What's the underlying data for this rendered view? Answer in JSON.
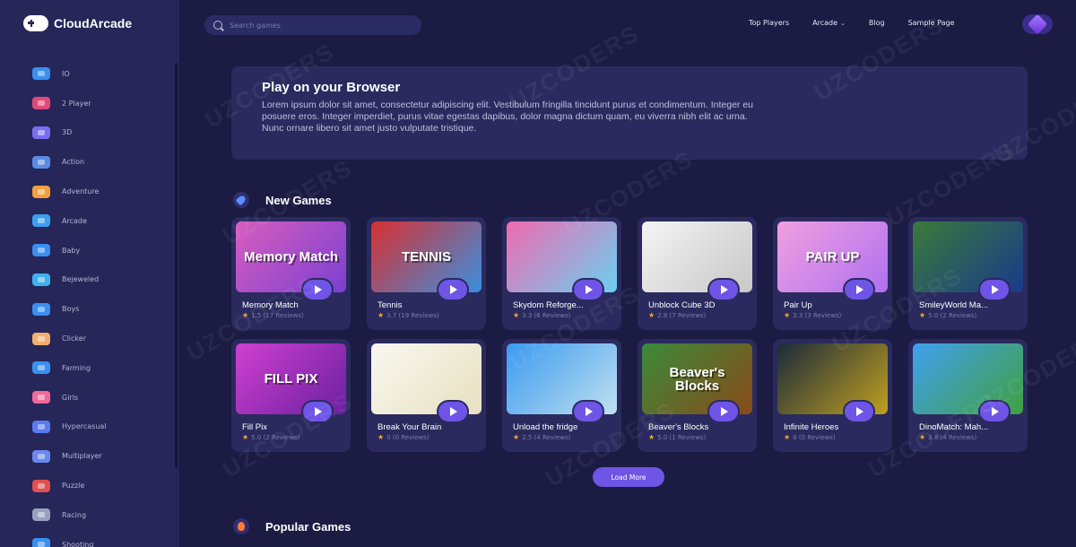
{
  "brand": {
    "name": "CloudArcade",
    "logo_icon": "gamepad-icon"
  },
  "search": {
    "placeholder": "Search games"
  },
  "nav": {
    "items": [
      {
        "label": "Top Players"
      },
      {
        "label": "Arcade",
        "has_dropdown": true,
        "chevron": "⌄"
      },
      {
        "label": "Blog"
      },
      {
        "label": "Sample Page"
      }
    ]
  },
  "sidebar": {
    "categories": [
      {
        "label": "IO",
        "icon": "gamepad-icon",
        "color": "#3a8ff0"
      },
      {
        "label": "2 Player",
        "icon": "two-player-icon",
        "color": "#e04a7a"
      },
      {
        "label": "3D",
        "icon": "cube-icon",
        "color": "#7a6cf0"
      },
      {
        "label": "Action",
        "icon": "swords-icon",
        "color": "#5a8be0"
      },
      {
        "label": "Adventure",
        "icon": "map-icon",
        "color": "#f0a040"
      },
      {
        "label": "Arcade",
        "icon": "arcade-icon",
        "color": "#3a9ff0"
      },
      {
        "label": "Baby",
        "icon": "gamepad-icon",
        "color": "#3a8ff0"
      },
      {
        "label": "Bejeweled",
        "icon": "diamond-icon",
        "color": "#40b0f0"
      },
      {
        "label": "Boys",
        "icon": "gamepad-icon",
        "color": "#3a8ff0"
      },
      {
        "label": "Clicker",
        "icon": "hand-pointer-icon",
        "color": "#f0b070"
      },
      {
        "label": "Farming",
        "icon": "gamepad-icon",
        "color": "#3a8ff0"
      },
      {
        "label": "Girls",
        "icon": "face-icon",
        "color": "#f06a9a"
      },
      {
        "label": "Hypercasual",
        "icon": "runner-icon",
        "color": "#5a7af0"
      },
      {
        "label": "Multiplayer",
        "icon": "players-icon",
        "color": "#6a8af0"
      },
      {
        "label": "Puzzle",
        "icon": "puzzle-icon",
        "color": "#e05050"
      },
      {
        "label": "Racing",
        "icon": "flag-icon",
        "color": "#9aa0c0"
      },
      {
        "label": "Shooting",
        "icon": "gamepad-icon",
        "color": "#3a8ff0"
      }
    ]
  },
  "hero": {
    "title": "Play on your Browser",
    "text": "Lorem ipsum dolor sit amet, consectetur adipiscing elit. Vestibulum fringilla tincidunt purus et condimentum. Integer eu posuere eros. Integer imperdiet, purus vitae egestas dapibus, dolor magna dictum quam, eu viverra nibh elit ac urna. Nunc ornare libero sit amet justo vulputate tristique."
  },
  "sections": {
    "new_games": {
      "title": "New Games",
      "icon": "rocket-icon"
    },
    "popular_games": {
      "title": "Popular Games",
      "icon": "fire-icon"
    }
  },
  "games": [
    {
      "title": "Memory Match",
      "rating": "1.5 (17 Reviews)",
      "thumb_text": "Memory Match",
      "colors": [
        "#d85ec0",
        "#7a3fd0"
      ]
    },
    {
      "title": "Tennis",
      "rating": "3.7 (19 Reviews)",
      "thumb_text": "TENNIS",
      "colors": [
        "#d83030",
        "#3a8fe0"
      ]
    },
    {
      "title": "Skydom Reforge...",
      "rating": "3.3 (6 Reviews)",
      "thumb_text": "",
      "colors": [
        "#f06ab0",
        "#6ad0f0"
      ]
    },
    {
      "title": "Unblock Cube 3D",
      "rating": "2.8 (7 Reviews)",
      "thumb_text": "",
      "colors": [
        "#f4f4f4",
        "#c8c8c8"
      ]
    },
    {
      "title": "Pair Up",
      "rating": "3.3 (3 Reviews)",
      "thumb_text": "PAIR UP",
      "colors": [
        "#f0a0e0",
        "#b070f0"
      ]
    },
    {
      "title": "SmileyWorld Ma...",
      "rating": "5.0 (2 Reviews)",
      "thumb_text": "",
      "colors": [
        "#3a7a3a",
        "#1a3a8a"
      ]
    },
    {
      "title": "Fill Pix",
      "rating": "5.0 (2 Reviews)",
      "thumb_text": "FILL PIX",
      "colors": [
        "#d040d0",
        "#6a20a0"
      ]
    },
    {
      "title": "Break Your Brain",
      "rating": "0 (0 Reviews)",
      "thumb_text": "",
      "colors": [
        "#f8f8f0",
        "#e8e0c0"
      ]
    },
    {
      "title": "Unload the fridge",
      "rating": "2.5 (4 Reviews)",
      "thumb_text": "",
      "colors": [
        "#3a9af0",
        "#c0e0f0"
      ]
    },
    {
      "title": "Beaver's Blocks",
      "rating": "5.0 (1 Reviews)",
      "thumb_text": "Beaver's Blocks",
      "colors": [
        "#3a8a3a",
        "#8a4a1a"
      ]
    },
    {
      "title": "Infinite Heroes",
      "rating": "0 (0 Reviews)",
      "thumb_text": "",
      "colors": [
        "#1a2a3a",
        "#c0a020"
      ]
    },
    {
      "title": "DinoMatch: Mah...",
      "rating": "3.8 (4 Reviews)",
      "thumb_text": "",
      "colors": [
        "#40a0f0",
        "#40a040"
      ]
    }
  ],
  "load_more": {
    "label": "Load More"
  },
  "watermark": "UZCODERS",
  "colors": {
    "background": "#1b1b43",
    "sidebar": "#262659",
    "card": "#2a2a5e",
    "accent": "#6e55e6",
    "star": "#f2a93b"
  }
}
